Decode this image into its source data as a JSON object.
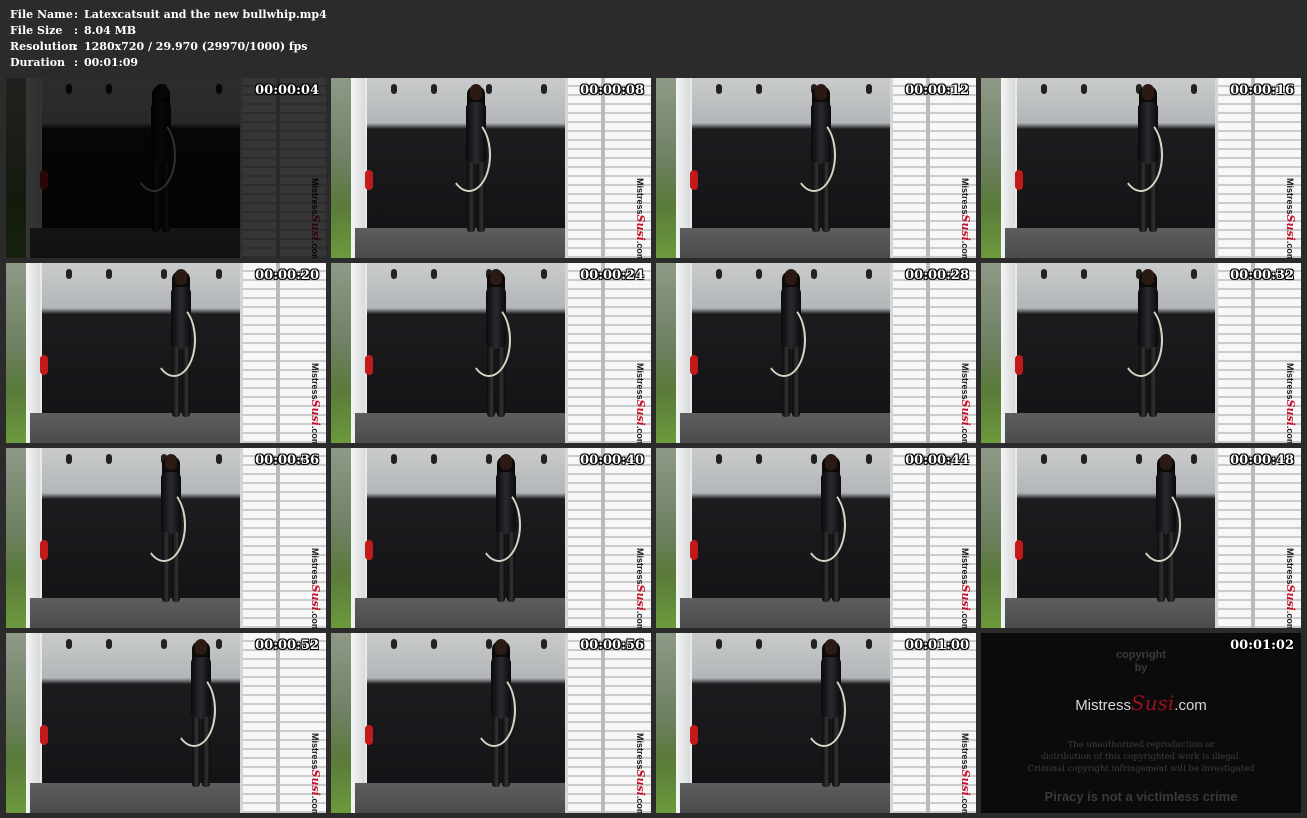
{
  "info": {
    "file_name_label": "File Name",
    "file_name": "Latexcatsuit and the new bullwhip.mp4",
    "file_size_label": "File Size",
    "file_size": "8.04 MB",
    "resolution_label": "Resolution",
    "resolution": "1280x720 / 29.970 (29970/1000) fps",
    "duration_label": "Duration",
    "duration": "00:01:09",
    "separator": ":"
  },
  "watermark": {
    "prefix": "Mistress",
    "accent": "Susi",
    "suffix": ".com"
  },
  "thumbnails": [
    {
      "time": "00:00:04"
    },
    {
      "time": "00:00:08"
    },
    {
      "time": "00:00:12"
    },
    {
      "time": "00:00:16"
    },
    {
      "time": "00:00:20"
    },
    {
      "time": "00:00:24"
    },
    {
      "time": "00:00:28"
    },
    {
      "time": "00:00:32"
    },
    {
      "time": "00:00:36"
    },
    {
      "time": "00:00:40"
    },
    {
      "time": "00:00:44"
    },
    {
      "time": "00:00:48"
    },
    {
      "time": "00:00:52"
    },
    {
      "time": "00:00:56"
    },
    {
      "time": "00:01:00"
    },
    {
      "time": "00:01:02"
    }
  ],
  "copyright_frame": {
    "title_line1": "copyright",
    "title_line2": "by",
    "brand_prefix": "Mistress",
    "brand_accent": "Susi",
    "brand_suffix": ".com",
    "notice_line1": "The unauthorized reproduction or",
    "notice_line2": "distribution of this copyrighted work is illegal.",
    "notice_line3": "Criminal copyright infringement will be investigated",
    "piracy": "Piracy is not a victimless crime"
  },
  "colors": {
    "background": "#2b2b2b",
    "accent_red": "#c5122a"
  }
}
